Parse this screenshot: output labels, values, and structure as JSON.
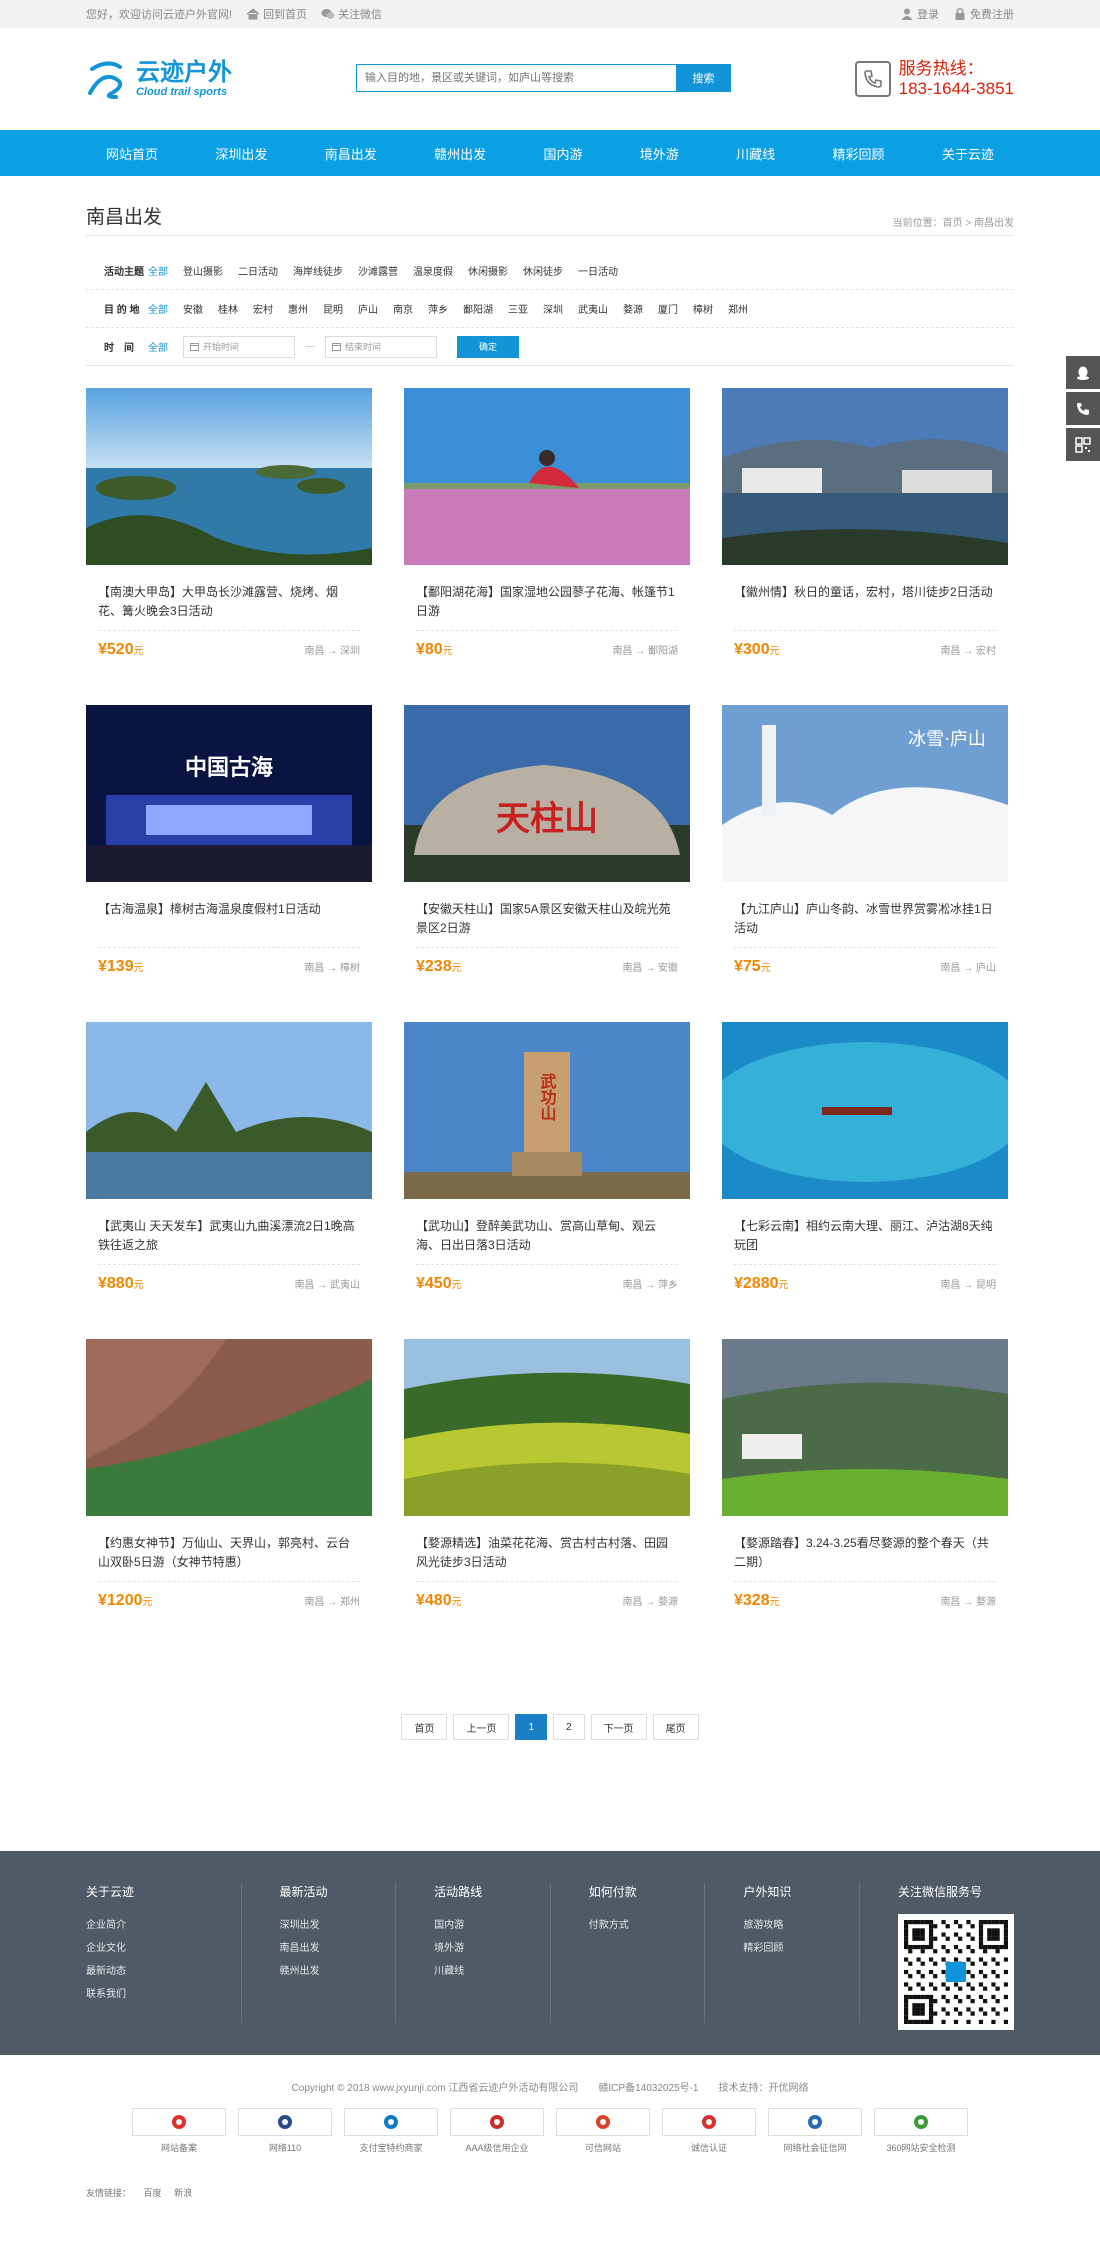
{
  "topbar": {
    "welcome": "您好，欢迎访问云迹户外官网!",
    "home_link": "回到首页",
    "wechat_link": "关注微信",
    "login": "登录",
    "register": "免费注册"
  },
  "header": {
    "logo_name": "云迹户外",
    "logo_en": "Cloud trail sports",
    "search_placeholder": "输入目的地，景区或关键词，如庐山等搜索",
    "search_button": "搜索",
    "hotline_label": "服务热线：",
    "hotline_number": "183-1644-3851"
  },
  "nav": [
    "网站首页",
    "深圳出发",
    "南昌出发",
    "赣州出发",
    "国内游",
    "境外游",
    "川藏线",
    "精彩回顾",
    "关于云迹"
  ],
  "page": {
    "title": "南昌出发",
    "breadcrumb": "当前位置：首页 > 南昌出发"
  },
  "filters": {
    "theme_label": "活动主题",
    "themes": [
      "全部",
      "登山摄影",
      "二日活动",
      "海岸线徒步",
      "沙滩露营",
      "温泉度假",
      "休闲摄影",
      "休闲徒步",
      "一日活动"
    ],
    "dest_label": "目 的 地",
    "dests": [
      "全部",
      "安徽",
      "桂林",
      "宏村",
      "惠州",
      "昆明",
      "庐山",
      "南京",
      "萍乡",
      "鄱阳湖",
      "三亚",
      "深圳",
      "武夷山",
      "婺源",
      "厦门",
      "樟树",
      "郑州"
    ],
    "time_label": "时　间",
    "time_all": "全部",
    "start_placeholder": "开始时间",
    "end_placeholder": "结束时间",
    "confirm": "确定"
  },
  "cards": [
    {
      "title": "【南澳大甲岛】大甲岛长沙滩露营、烧烤、烟花、篝火晚会3日活动",
      "price": "¥520",
      "unit": "元",
      "route": "南昌 → 深圳",
      "scene": "island"
    },
    {
      "title": "【鄱阳湖花海】国家湿地公园蓼子花海、帐篷节1日游",
      "price": "¥80",
      "unit": "元",
      "route": "南昌 → 鄱阳湖",
      "scene": "flowers"
    },
    {
      "title": "【徽州情】秋日的童话，宏村，塔川徒步2日活动",
      "price": "¥300",
      "unit": "元",
      "route": "南昌 → 宏村",
      "scene": "village"
    },
    {
      "title": "【古海温泉】樟树古海温泉度假村1日活动",
      "price": "¥139",
      "unit": "元",
      "route": "南昌 → 樟树",
      "scene": "night"
    },
    {
      "title": "【安徽天柱山】国家5A景区安徽天柱山及皖光苑景区2日游",
      "price": "¥238",
      "unit": "元",
      "route": "南昌 → 安徽",
      "scene": "rock"
    },
    {
      "title": "【九江庐山】庐山冬韵、冰雪世界赏雾凇冰挂1日活动",
      "price": "¥75",
      "unit": "元",
      "route": "南昌 → 庐山",
      "scene": "snow"
    },
    {
      "title": "【武夷山 天天发车】武夷山九曲溪漂流2日1晚高铁往返之旅",
      "price": "¥880",
      "unit": "元",
      "route": "南昌 → 武夷山",
      "scene": "peaks"
    },
    {
      "title": "【武功山】登醉美武功山、赏高山草甸、观云海、日出日落3日活动",
      "price": "¥450",
      "unit": "元",
      "route": "南昌 → 萍乡",
      "scene": "stele"
    },
    {
      "title": "【七彩云南】相约云南大理、丽江、泸沽湖8天纯玩团",
      "price": "¥2880",
      "unit": "元",
      "route": "南昌 → 昆明",
      "scene": "lake"
    },
    {
      "title": "【约惠女神节】万仙山、天界山，郭亮村、云台山双卧5日游（女神节特惠）",
      "price": "¥1200",
      "unit": "元",
      "route": "南昌 → 郑州",
      "scene": "cliff"
    },
    {
      "title": "【婺源精选】油菜花花海、赏古村古村落、田园风光徒步3日活动",
      "price": "¥480",
      "unit": "元",
      "route": "南昌 → 婺源",
      "scene": "terraces"
    },
    {
      "title": "【婺源踏春】3.24-3.25看尽婺源的整个春天（共二期）",
      "price": "¥328",
      "unit": "元",
      "route": "南昌 → 婺源",
      "scene": "valley"
    }
  ],
  "sign_texts": {
    "night": "中国古海",
    "rock": "天柱山",
    "snow": "冰雪·庐山",
    "stele": "武功山"
  },
  "pager": [
    "首页",
    "上一页",
    "1",
    "2",
    "下一页",
    "尾页"
  ],
  "pager_current": "1",
  "footer": {
    "cols": [
      {
        "head": "关于云迹",
        "items": [
          "企业简介",
          "企业文化",
          "最新动态",
          "联系我们"
        ]
      },
      {
        "head": "最新活动",
        "items": [
          "深圳出发",
          "南昌出发",
          "赣州出发"
        ]
      },
      {
        "head": "活动路线",
        "items": [
          "国内游",
          "境外游",
          "川藏线"
        ]
      },
      {
        "head": "如何付款",
        "items": [
          "付款方式"
        ]
      },
      {
        "head": "户外知识",
        "items": [
          "旅游攻略",
          "精彩回顾"
        ]
      }
    ],
    "wechat_head": "关注微信服务号"
  },
  "copyright": "Copyright © 2018 www.jxyunji.com 江西省云迹户外活动有限公司　　赣ICP备14032025号-1　　技术支持：开优网络",
  "badges": [
    {
      "label": "网站备案",
      "icon": "police-shield-icon",
      "color": "#e0302a"
    },
    {
      "label": "网络110",
      "icon": "net-police-icon",
      "color": "#2a4a8c"
    },
    {
      "label": "支付宝特约商家",
      "icon": "alipay-icon",
      "color": "#0e7bc4"
    },
    {
      "label": "AAA级信用企业",
      "icon": "credit-seal-icon",
      "color": "#c8302a"
    },
    {
      "label": "可信网站",
      "icon": "trusted-site-icon",
      "color": "#d8432a"
    },
    {
      "label": "诚信认证",
      "icon": "integrity-icon",
      "color": "#d8302a"
    },
    {
      "label": "网络社会征信网",
      "icon": "credit-net-icon",
      "color": "#2a6ab4"
    },
    {
      "label": "360网站安全检测",
      "icon": "security-check-icon",
      "color": "#3a9a3a"
    }
  ],
  "friend_links": {
    "label": "友情链接：",
    "items": [
      "百度",
      "新浪"
    ]
  },
  "colors": {
    "accent": "#1294d8",
    "nav": "#0ba0e4",
    "price": "#f28600",
    "hotline": "#d81e06",
    "footer": "#4e5a66"
  }
}
